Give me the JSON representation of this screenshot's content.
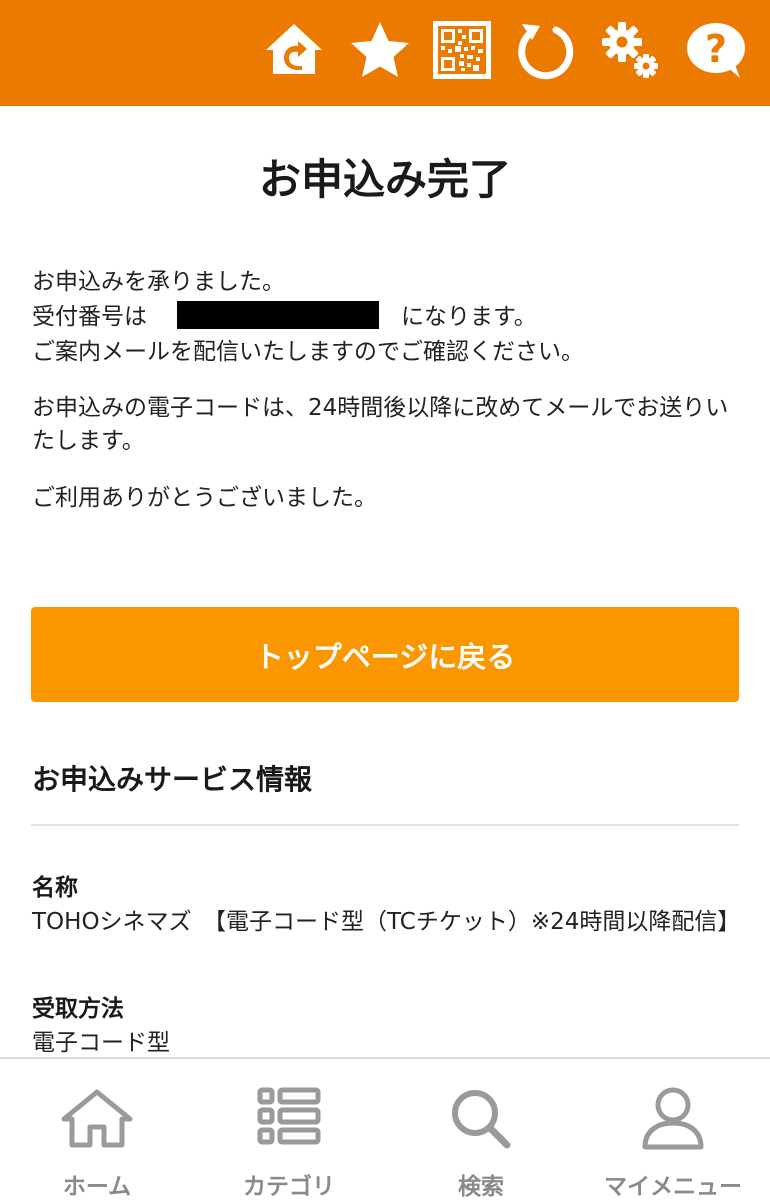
{
  "header": {
    "background_color": "#ea7a00",
    "icons": [
      "home-return-icon",
      "star-icon",
      "qr-code-icon",
      "refresh-icon",
      "gear-icon",
      "help-icon"
    ]
  },
  "page": {
    "title": "お申込み完了"
  },
  "message": {
    "line1": "お申込みを承りました。",
    "line2_prefix": "受付番号は",
    "line2_suffix": "になります。",
    "line3": "ご案内メールを配信いたしますのでご確認ください。",
    "line4": "お申込みの電子コードは、24時間後以降に改めてメールでお送りいたします。",
    "line5": "ご利用ありがとうございました。"
  },
  "actions": {
    "top_page_button": "トップページに戻る",
    "button_color": "#fa9700"
  },
  "service_info": {
    "section_title": "お申込みサービス情報",
    "name_label": "名称",
    "name_value": "TOHOシネマズ　【電子コード型（TCチケット）※24時間以降配信】",
    "method_label": "受取方法",
    "method_value": "電子コード型"
  },
  "bottom_nav": {
    "items": [
      {
        "label": "ホーム",
        "icon": "home-icon"
      },
      {
        "label": "カテゴリ",
        "icon": "category-list-icon"
      },
      {
        "label": "検索",
        "icon": "search-icon"
      },
      {
        "label": "マイメニュー",
        "icon": "user-icon"
      }
    ],
    "label_color": "#8a8a8a"
  }
}
